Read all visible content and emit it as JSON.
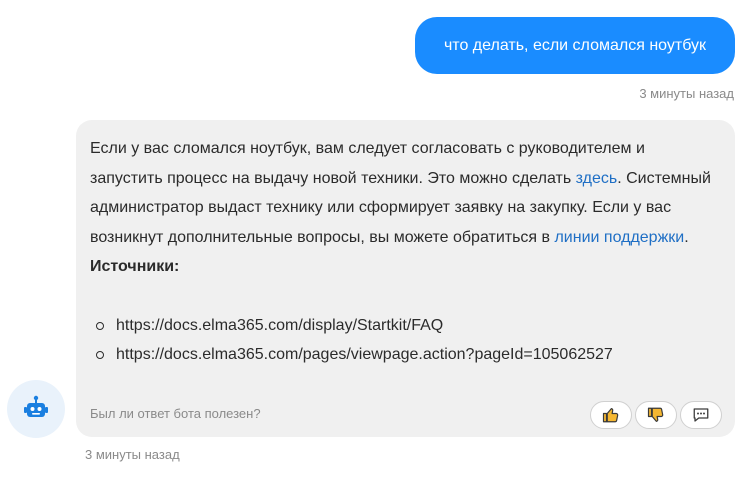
{
  "user_message": {
    "text": "что делать, если сломался ноутбук",
    "time": "3 минуты назад"
  },
  "bot_message": {
    "paragraph": {
      "part1": "Если у вас сломался ноутбук, вам следует согласовать с руководителем и запустить процесс на выдачу новой техники. Это можно сделать ",
      "link1": "здесь",
      "part2": ". Системный администратор выдаст технику или сформирует заявку на закупку. Если у вас возникнут дополнительные вопросы, вы можете обратиться в ",
      "link2": "линии поддержки",
      "part3": "."
    },
    "sources_title": "Источники:",
    "sources": [
      "https://docs.elma365.com/display/Startkit/FAQ",
      "https://docs.elma365.com/pages/viewpage.action?pageId=105062527"
    ],
    "feedback_question": "Был ли ответ бота полезен?",
    "feedback_icons": [
      "thumbs-up-icon",
      "thumbs-down-icon",
      "comment-icon"
    ],
    "time": "3 минуты назад"
  },
  "colors": {
    "user_bubble": "#1a8cff",
    "bot_bubble": "#f0f0f0",
    "link": "#1f6fc5",
    "thumb_fill": "#f5b731",
    "bot_icon": "#1a7fe0"
  }
}
